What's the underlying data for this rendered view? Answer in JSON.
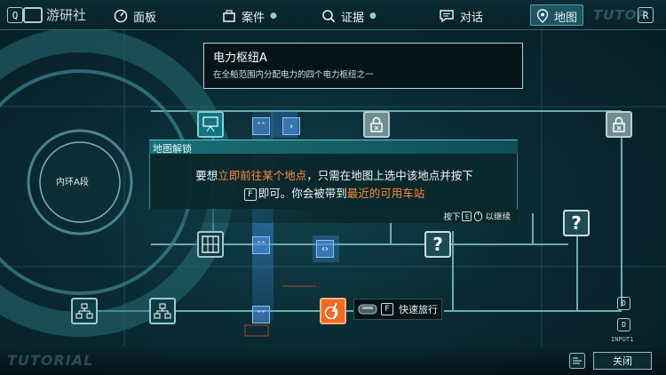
{
  "nav": {
    "left_key": "Q",
    "right_key": "R",
    "items": [
      {
        "label": "面板",
        "icon": "dashboard-icon"
      },
      {
        "label": "案件",
        "icon": "case-icon"
      },
      {
        "label": "证据",
        "icon": "search-icon"
      },
      {
        "label": "对话",
        "icon": "chat-icon"
      },
      {
        "label": "地图",
        "icon": "map-pin-icon",
        "active": true
      }
    ],
    "ghost": "TUTOR"
  },
  "watermark": "游研社",
  "info_panel": {
    "title": "电力枢纽A",
    "description": "在全船范围内分配电力的四个电力枢纽之一"
  },
  "tutorial": {
    "title": "地图解锁",
    "line1_before": "要想",
    "line1_highlight": "立即前往某个地点",
    "line1_after": "，只需在地图上选中该地点并按下",
    "line2_key": "F",
    "line2_before": "即可。你会被带到",
    "line2_highlight": "最近的可用车站",
    "footer_prefix": "按下",
    "footer_key": "E",
    "footer_suffix": "以继续"
  },
  "map": {
    "ring_label": "内环A段",
    "fast_travel_key": "F",
    "fast_travel_label": "快速旅行",
    "side_keys": [
      "D",
      "D"
    ],
    "input_label": "INPUT1",
    "ghost_bottom": "TUTORIAL"
  },
  "footer": {
    "close_label": "关闭"
  },
  "colors": {
    "accent": "#ef6a22",
    "highlight_text": "#ff8a3c",
    "panel_teal": "#1a6f78",
    "chevron_blue": "#5096e6"
  }
}
